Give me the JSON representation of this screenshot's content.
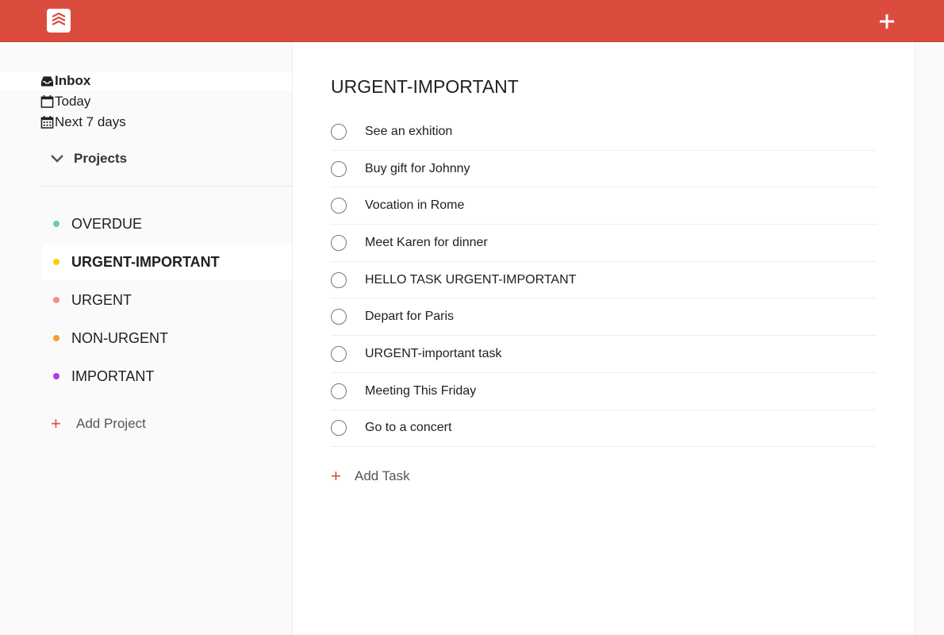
{
  "topbar": {
    "background": "#db4c3f",
    "logo_icon": "todoist-logo-icon",
    "add_icon": "plus-icon"
  },
  "sidebar": {
    "nav": [
      {
        "label": "Inbox",
        "icon": "inbox-icon",
        "active": true
      },
      {
        "label": "Today",
        "icon": "calendar-icon",
        "active": false
      },
      {
        "label": "Next 7 days",
        "icon": "calendar-grid-icon",
        "active": false
      }
    ],
    "projects_label": "Projects",
    "projects": [
      {
        "label": "OVERDUE",
        "color": "#6accbc",
        "active": false
      },
      {
        "label": "URGENT-IMPORTANT",
        "color": "#fad000",
        "active": true
      },
      {
        "label": "URGENT",
        "color": "#f08f8a",
        "active": false
      },
      {
        "label": "NON-URGENT",
        "color": "#ff9933",
        "active": false
      },
      {
        "label": "IMPORTANT",
        "color": "#af38eb",
        "active": false
      }
    ],
    "add_project_symbol": "+",
    "add_project_label": "Add Project"
  },
  "main": {
    "title": "URGENT-IMPORTANT",
    "tasks": [
      "See an exhition",
      "Buy gift for Johnny",
      "Vocation in Rome",
      "Meet Karen for dinner",
      "HELLO TASK URGENT-IMPORTANT",
      "Depart for Paris",
      "URGENT-important task",
      "Meeting This Friday",
      "Go to a concert"
    ],
    "add_task_symbol": "+",
    "add_task_label": "Add Task"
  }
}
